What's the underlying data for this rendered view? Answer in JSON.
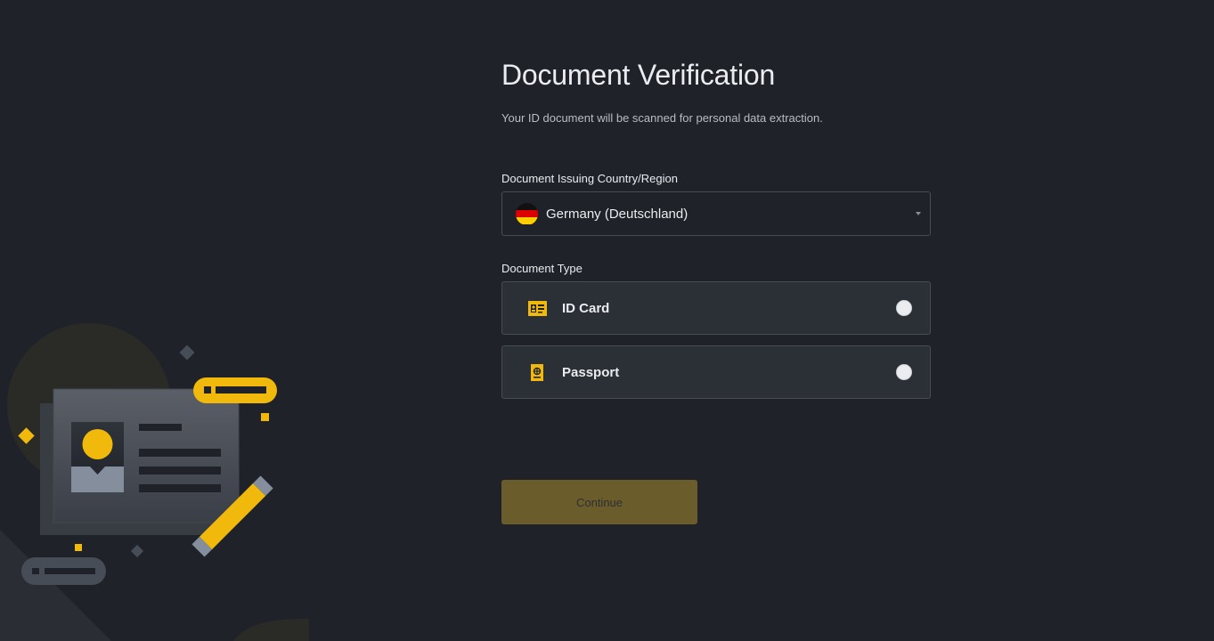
{
  "page": {
    "title": "Document Verification",
    "subtitle": "Your ID document will be scanned for personal data extraction."
  },
  "country": {
    "label": "Document Issuing Country/Region",
    "selected": "Germany (Deutschland)",
    "flag_icon": "germany-flag-icon"
  },
  "document_type": {
    "label": "Document Type",
    "options": [
      {
        "label": "ID Card",
        "icon": "id-card-icon",
        "selected": false
      },
      {
        "label": "Passport",
        "icon": "passport-icon",
        "selected": false
      }
    ]
  },
  "actions": {
    "continue_label": "Continue",
    "continue_enabled": false
  },
  "colors": {
    "background": "#1f2229",
    "panel": "#2b2f36",
    "border": "#474d57",
    "accent": "#f0b90b",
    "button_disabled": "#6b5d2b"
  }
}
